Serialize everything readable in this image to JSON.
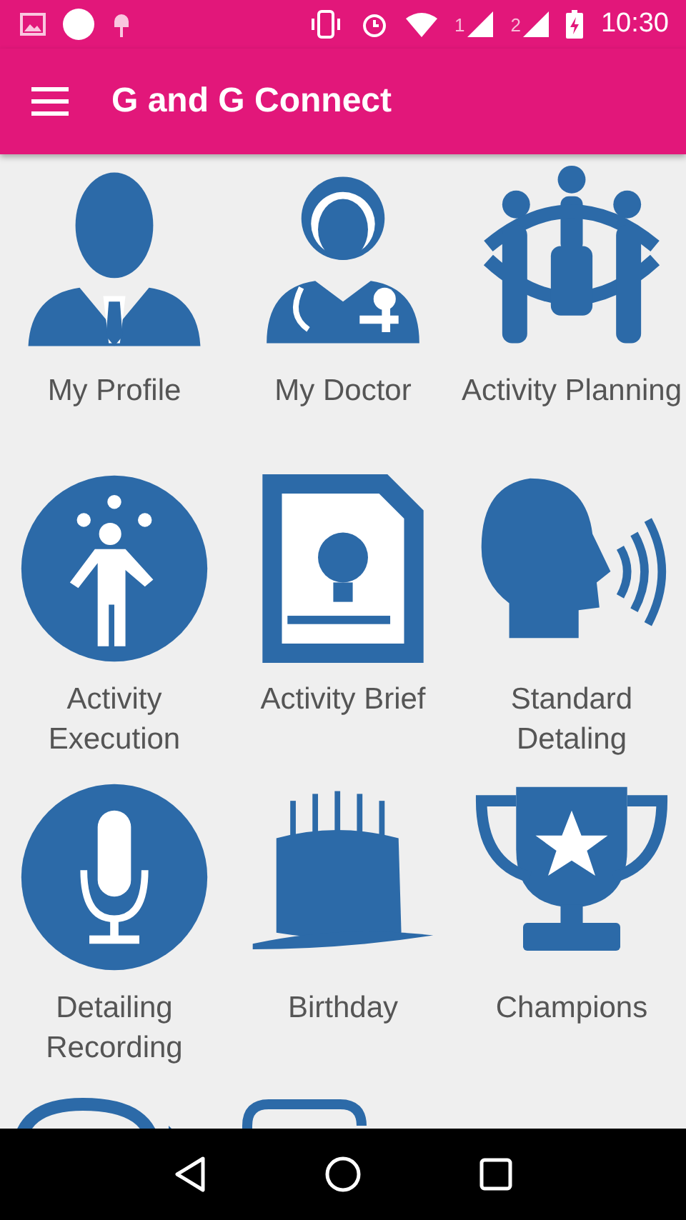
{
  "status_bar": {
    "time": "10:30",
    "sim_1": "1",
    "sim_2": "2"
  },
  "app_bar": {
    "title": "G and G Connect"
  },
  "tiles": [
    {
      "label": "My Profile"
    },
    {
      "label": "My Doctor"
    },
    {
      "label": "Activity Planning"
    },
    {
      "label": "Activity Execution"
    },
    {
      "label": "Activity Brief"
    },
    {
      "label": "Standard Detaling"
    },
    {
      "label": "Detailing Recording"
    },
    {
      "label": "Birthday"
    },
    {
      "label": "Champions"
    }
  ]
}
